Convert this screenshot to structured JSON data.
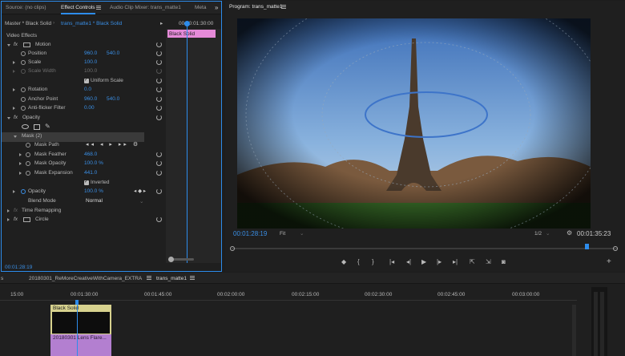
{
  "effect_controls": {
    "tabs": [
      "Source: (no clips)",
      "Effect Controls",
      "Audio Clip Mixer: trans_matte1",
      "Meta"
    ],
    "master_label": "Master * Black Solid",
    "sequence_clip": "trans_matte1 * Black Solid",
    "timecode_head": "00:00:01:30:00",
    "clip_name": "Black Solid",
    "section": "Video Effects",
    "motion": "Motion",
    "position": {
      "label": "Position",
      "x": "960.0",
      "y": "540.0"
    },
    "scale": {
      "label": "Scale",
      "value": "100.0"
    },
    "scale_width": {
      "label": "Scale Width",
      "value": "100.0"
    },
    "uniform_scale": "Uniform Scale",
    "rotation": {
      "label": "Rotation",
      "value": "0.0"
    },
    "anchor": {
      "label": "Anchor Point",
      "x": "960.0",
      "y": "540.0"
    },
    "anti_flicker": {
      "label": "Anti-flicker Filter",
      "value": "0.00"
    },
    "opacity_group": "Opacity",
    "mask": "Mask (2)",
    "mask_path": "Mask Path",
    "mask_feather": {
      "label": "Mask Feather",
      "value": "468.0"
    },
    "mask_opacity": {
      "label": "Mask Opacity",
      "value": "100.0 %"
    },
    "mask_expansion": {
      "label": "Mask Expansion",
      "value": "441.0"
    },
    "inverted": "Inverted",
    "opacity": {
      "label": "Opacity",
      "value": "100.0 %"
    },
    "blend": {
      "label": "Blend Mode",
      "value": "Normal"
    },
    "time_remap": "Time Remapping",
    "circle": "Circle",
    "footer_time": "00:01:28:19"
  },
  "program": {
    "title": "Program: trans_matte1",
    "current_time": "00:01:28:19",
    "fit": "Fit",
    "resolution": "1/2",
    "duration": "00:01:35:23"
  },
  "timeline": {
    "tabs": [
      "20180301_ReMoreCreativeWithCamera_EXTRA",
      "trans_matte1"
    ],
    "ruler": [
      "15:00",
      "00:01:30:00",
      "00:01:45:00",
      "00:02:00:00",
      "00:02:15:00",
      "00:02:30:00",
      "00:02:45:00",
      "00:03:00:00"
    ],
    "clip_label": "Black Solid",
    "clip_sub": "20180301 Lens Flare..."
  }
}
